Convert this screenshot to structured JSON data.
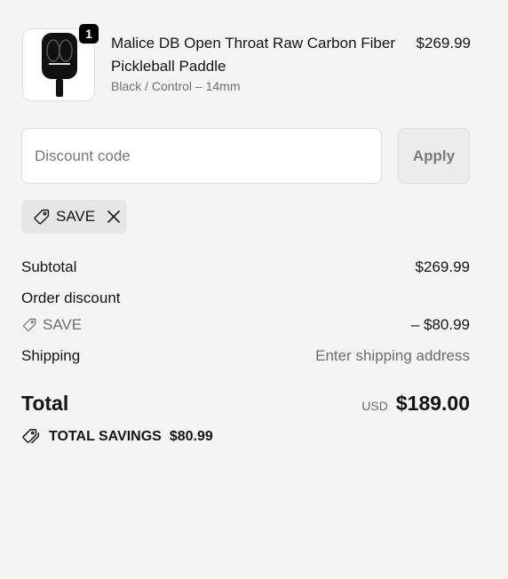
{
  "product": {
    "quantity": "1",
    "name": "Malice DB Open Throat Raw Carbon Fiber Pickleball Paddle",
    "variant": "Black / Control – 14mm",
    "price": "$269.99"
  },
  "discount": {
    "placeholder": "Discount code",
    "apply_label": "Apply",
    "applied_code": "SAVE"
  },
  "summary": {
    "subtotal_label": "Subtotal",
    "subtotal_value": "$269.99",
    "order_discount_label": "Order discount",
    "discount_code": "SAVE",
    "discount_value": "– $80.99",
    "shipping_label": "Shipping",
    "shipping_value": "Enter shipping address",
    "total_label": "Total",
    "currency": "USD",
    "total_value": "$189.00",
    "savings_label": "TOTAL SAVINGS",
    "savings_value": "$80.99"
  },
  "icons": {
    "tag": "tag-icon",
    "close": "close-icon",
    "savings": "double-tag-icon"
  },
  "colors": {
    "background": "#f4f4f4",
    "text": "#141414",
    "muted": "#6b6b6b",
    "badge": "#000000"
  }
}
